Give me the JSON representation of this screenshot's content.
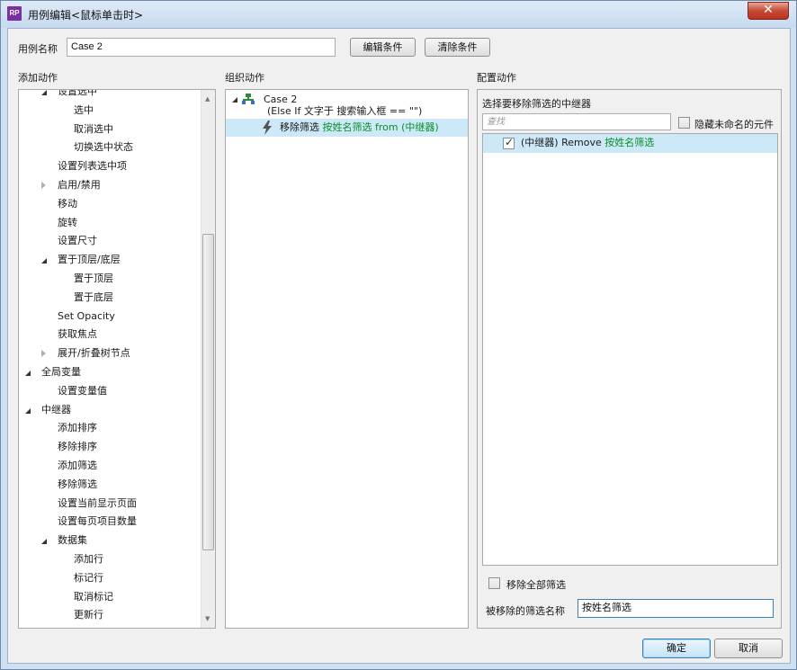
{
  "window": {
    "title": "用例编辑<鼠标单击时>",
    "app_icon": "RP",
    "close_glyph": "✕"
  },
  "case_name": {
    "label": "用例名称",
    "value": "Case 2",
    "edit_condition": "编辑条件",
    "clear_condition": "清除条件"
  },
  "add_action": {
    "heading": "添加动作",
    "items": [
      {
        "label": "设置选中",
        "level": 1,
        "toggle": "expanded"
      },
      {
        "label": "选中",
        "level": 2
      },
      {
        "label": "取消选中",
        "level": 2
      },
      {
        "label": "切换选中状态",
        "level": 2
      },
      {
        "label": "设置列表选中项",
        "level": 1
      },
      {
        "label": "启用/禁用",
        "level": 1,
        "toggle": "collapsed"
      },
      {
        "label": "移动",
        "level": 1
      },
      {
        "label": "旋转",
        "level": 1
      },
      {
        "label": "设置尺寸",
        "level": 1
      },
      {
        "label": "置于顶层/底层",
        "level": 1,
        "toggle": "expanded"
      },
      {
        "label": "置于顶层",
        "level": 2
      },
      {
        "label": "置于底层",
        "level": 2
      },
      {
        "label": "Set Opacity",
        "level": 1
      },
      {
        "label": "获取焦点",
        "level": 1
      },
      {
        "label": "展开/折叠树节点",
        "level": 1,
        "toggle": "collapsed"
      },
      {
        "label": "全局变量",
        "level": 0,
        "toggle": "expanded"
      },
      {
        "label": "设置变量值",
        "level": 1
      },
      {
        "label": "中继器",
        "level": 0,
        "toggle": "expanded"
      },
      {
        "label": "添加排序",
        "level": 1
      },
      {
        "label": "移除排序",
        "level": 1
      },
      {
        "label": "添加筛选",
        "level": 1
      },
      {
        "label": "移除筛选",
        "level": 1
      },
      {
        "label": "设置当前显示页面",
        "level": 1
      },
      {
        "label": "设置每页项目数量",
        "level": 1
      },
      {
        "label": "数据集",
        "level": 1,
        "toggle": "expanded"
      },
      {
        "label": "添加行",
        "level": 2
      },
      {
        "label": "标记行",
        "level": 2
      },
      {
        "label": "取消标记",
        "level": 2
      },
      {
        "label": "更新行",
        "level": 2
      }
    ]
  },
  "organize": {
    "heading": "组织动作",
    "case_title": "Case 2",
    "case_condition": "(Else If 文字于 搜索输入框 == \"\")",
    "action_prefix": "移除筛选 ",
    "action_target": "按姓名筛选 from (中继器)"
  },
  "configure": {
    "heading": "配置动作",
    "subheading": "选择要移除筛选的中继器",
    "search_placeholder": "查找",
    "hide_unnamed": "隐藏未命名的元件",
    "repeater_item_prefix": "(中继器) Remove ",
    "repeater_item_name": "按姓名筛选",
    "remove_all": "移除全部筛选",
    "filter_name_label": "被移除的筛选名称",
    "filter_name_value": "按姓名筛选"
  },
  "footer": {
    "ok": "确定",
    "cancel": "取消"
  },
  "colors": {
    "highlight": "#cde8f7",
    "link_green": "#0a8f2a",
    "title_bar": "#c6d9ef"
  }
}
